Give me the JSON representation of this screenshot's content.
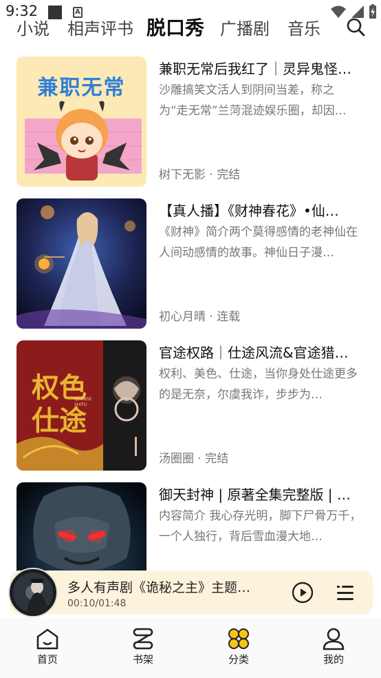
{
  "status_bar": {
    "time": "9:32",
    "notif_icon": "A"
  },
  "tabs": [
    {
      "label": "小说",
      "active": false
    },
    {
      "label": "相声评书",
      "active": false
    },
    {
      "label": "脱口秀",
      "active": true
    },
    {
      "label": "广播剧",
      "active": false
    },
    {
      "label": "音乐",
      "active": false
    }
  ],
  "books": [
    {
      "title": "兼职无常后我红了｜灵异鬼怪…",
      "desc": "沙雕搞笑文活人到阴间当差，称之为“走无常”兰菏混迹娱乐圈，却因…",
      "author": "树下无影",
      "status": "完结",
      "meta": "树下无影 · 完结",
      "cover_text": "兼职无常"
    },
    {
      "title": "【真人播】《财神春花》•仙…",
      "desc": "《财神》简介两个莫得感情的老神仙在人间动感情的故事。神仙日子漫…",
      "author": "初心月晴",
      "status": "连载",
      "meta": "初心月晴 · 连载"
    },
    {
      "title": "官途权路｜仕途风流&官途猎…",
      "desc": "权利、美色、仕途，当你身处仕途更多的是无奈，尔虞我诈，步步为…",
      "author": "汤圈圈",
      "status": "完结",
      "meta": "汤圈圈 · 完结",
      "cover_text": "权色仕途",
      "cover_sub": "QUANSE SHITU"
    },
    {
      "title": "御天封神 | 原著全集完整版 | …",
      "desc": "内容简介 我心存光明，脚下尸骨万千，一个人独行，背后雪血漫大地…",
      "author": "",
      "status": "",
      "meta": ""
    }
  ],
  "player": {
    "title": "多人有声剧《诡秘之主》主题…",
    "current_time": "00:10",
    "duration": "01:48",
    "time_display": "00:10/01:48"
  },
  "bottom_nav": [
    {
      "label": "首页",
      "icon": "home-icon",
      "active": false
    },
    {
      "label": "书架",
      "icon": "bookshelf-icon",
      "active": false
    },
    {
      "label": "分类",
      "icon": "category-icon",
      "active": true
    },
    {
      "label": "我的",
      "icon": "profile-icon",
      "active": false
    }
  ],
  "colors": {
    "accent": "#f5c518",
    "player_bg": "#fdf3dc",
    "text_primary": "#111111",
    "text_secondary": "#777777"
  }
}
